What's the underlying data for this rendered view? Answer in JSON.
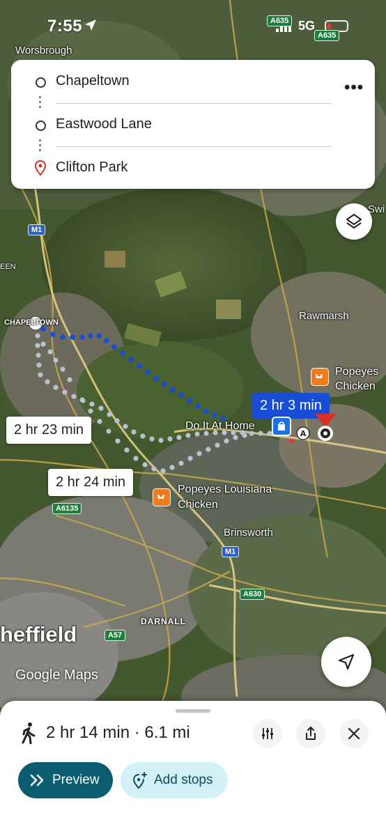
{
  "status": {
    "time": "7:55",
    "network": "5G"
  },
  "route_card": {
    "stops": [
      {
        "label": "Chapeltown"
      },
      {
        "label": "Eastwood Lane"
      },
      {
        "label": "Clifton Park"
      }
    ],
    "more_label": "•••"
  },
  "map": {
    "place_labels": {
      "worsbrough": "Worsbrough",
      "chapeltown": "CHAPELTOWN",
      "rawmarsh": "Rawmarsh",
      "brinsworth": "Brinsworth",
      "darnall": "DARNALL",
      "sheffield": "heffield",
      "een": "EEN",
      "swi": "Swi"
    },
    "road_shields": {
      "a635_top": "A635",
      "a635_right": "A635",
      "m1_top": "M1",
      "m1_bottom": "M1",
      "a6135": "A6135",
      "a630": "A630",
      "a57": "A57"
    },
    "poi": {
      "popeyes_right": "Popeyes Chicken",
      "popeyes_right_line1": "Popeyes",
      "popeyes_right_line2": "Chicken",
      "popeyes_left_line1": "Popeyes Louisiana",
      "popeyes_left_line2": "Chicken",
      "do_it_at_home": "Do It At Home"
    },
    "route_times": {
      "selected": "2 hr 3 min",
      "alt1": "2 hr 23 min",
      "alt2": "2 hr 24 min"
    },
    "marker_a": "A",
    "attribution": "Google Maps",
    "colors": {
      "route_selected": "#1a4dd6",
      "route_alt": "#b9c3cf",
      "destination": "#d93025"
    }
  },
  "sheet": {
    "summary": "2 hr 14 min · 6.1 mi",
    "preview_label": "Preview",
    "add_stops_label": "Add stops",
    "icons": [
      "walking-icon",
      "tune-icon",
      "share-icon",
      "close-icon",
      "preview-chevrons-icon",
      "add-stop-pin-icon"
    ]
  }
}
